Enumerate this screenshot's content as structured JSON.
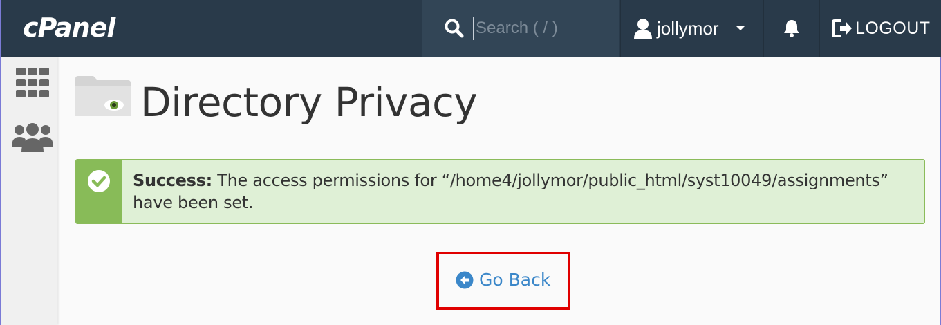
{
  "header": {
    "logo_text": "cPanel",
    "search": {
      "placeholder": "Search ( / )"
    },
    "user": {
      "name": "jollymor"
    },
    "logout_label": "LOGOUT"
  },
  "sidebar": {
    "items": [
      {
        "name": "applications-grid",
        "icon": "grid-icon"
      },
      {
        "name": "users",
        "icon": "users-icon"
      }
    ]
  },
  "page": {
    "title": "Directory Privacy",
    "title_icon": "folder-eye-icon"
  },
  "alert": {
    "type": "success",
    "label": "Success:",
    "message": "The access permissions for “/home4/jollymor/public_html/syst10049/assignments” have been set."
  },
  "actions": {
    "go_back_label": "Go Back"
  },
  "colors": {
    "topbar": "#293a4a",
    "search_bg": "#324556",
    "alert_bg": "#dff0d6",
    "alert_accent": "#88bb58",
    "link": "#3b87c9",
    "highlight": "#e00000"
  }
}
